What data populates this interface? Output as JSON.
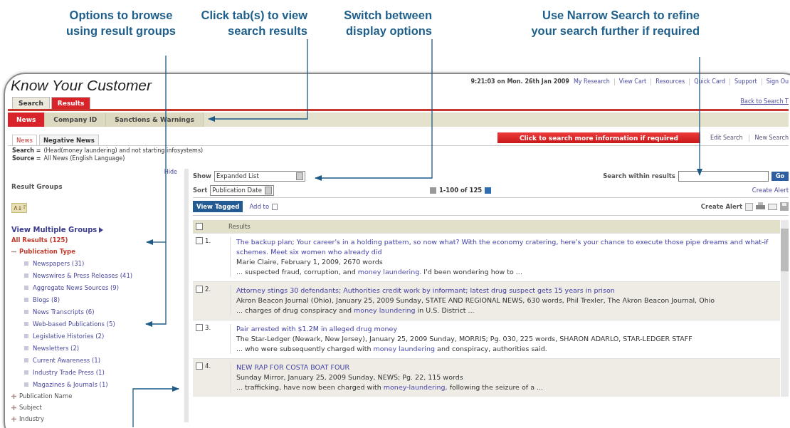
{
  "annotations": [
    {
      "lines": [
        "Options to browse",
        "using result groups"
      ]
    },
    {
      "lines": [
        "Click tab(s) to view",
        "search results"
      ]
    },
    {
      "lines": [
        "Switch between",
        "display options"
      ]
    },
    {
      "lines": [
        "Use Narrow Search to refine",
        "your search further if required"
      ]
    }
  ],
  "header": {
    "title": "Know Your Customer",
    "timestamp": "9:21:03 on Mon. 26th Jan 2009",
    "links": [
      "My Research",
      "View Cart",
      "Resources",
      "Quick Card",
      "Support",
      "Sign Ou"
    ],
    "back_link": "Back to Search T"
  },
  "tabs": [
    {
      "label": "Search",
      "selected": false
    },
    {
      "label": "Results",
      "selected": true
    }
  ],
  "subtabs": [
    {
      "label": "News",
      "selected": true
    },
    {
      "label": "Company ID",
      "selected": false
    },
    {
      "label": "Sanctions & Warnings",
      "selected": false
    }
  ],
  "news_tabs": [
    {
      "label": "News",
      "selected": true
    },
    {
      "label": "Negative News",
      "selected": false
    }
  ],
  "action_button": "Click to search more information if required",
  "search_links": [
    "Edit Search",
    "New Search"
  ],
  "query": {
    "search_label": "Search =",
    "search_value": "(Head(money laundering) and not starting infosystems)",
    "source_label": "Source =",
    "source_value": "All News (English Language)"
  },
  "sidebar": {
    "hide": "Hide",
    "title": "Result Groups",
    "view_multiple": "View Multiple Groups",
    "all_results": "All Results (125)",
    "groups": [
      {
        "label": "Publication Type",
        "expanded": true,
        "children": [
          {
            "label": "Newspapers (31)"
          },
          {
            "label": "Newswires & Press Releases (41)"
          },
          {
            "label": "Aggregate News Sources (9)"
          },
          {
            "label": "Blogs (8)"
          },
          {
            "label": "News Transcripts (6)"
          },
          {
            "label": "Web-based Publications (5)"
          },
          {
            "label": "Legislative Histories (2)"
          },
          {
            "label": "Newsletters (2)"
          },
          {
            "label": "Current Awareness (1)"
          },
          {
            "label": "Industry Trade Press (1)"
          },
          {
            "label": "Magazines & Journals (1)"
          }
        ]
      },
      {
        "label": "Publication Name",
        "expanded": false
      },
      {
        "label": "Subject",
        "expanded": false
      },
      {
        "label": "Industry",
        "expanded": false
      }
    ]
  },
  "toolbar": {
    "show_label": "Show",
    "show_value": "Expanded List",
    "sort_label": "Sort",
    "sort_value": "Publication Date",
    "range": "1-100 of 125",
    "search_within_label": "Search within results",
    "go": "Go",
    "create_alert_link": "Create Alert",
    "view_tagged": "View Tagged",
    "add_to": "Add to",
    "create_alert": "Create Alert"
  },
  "results": {
    "header": "Results",
    "all_checked": false,
    "rows": [
      {
        "number": "1.",
        "checked": false,
        "title": "The backup plan; Your career's in a holding pattern, so now what? With the economy cratering, here's your chance to execute those pipe dreams and what-if schemes. Meet six women who already did",
        "meta": "Marie Claire, February 1, 2009, 2670 words",
        "snippet": {
          "before": "... suspected fraud, corruption, and",
          "term": "money laundering.",
          "after": "I'd been wondering how to  ..."
        }
      },
      {
        "number": "2.",
        "checked": false,
        "title": "Attorney stings 30 defendants; Authorities credit work by informant; latest drug suspect gets 15 years in prison",
        "meta": "Akron Beacon Journal (Ohio), January 25, 2009 Sunday, STATE AND REGIONAL NEWS, 630 words, Phil Trexler, The Akron Beacon Journal, Ohio",
        "snippet": {
          "before": "... charges of drug conspiracy and",
          "term": "money laundering",
          "after": "in U.S. District  ..."
        }
      },
      {
        "number": "3.",
        "checked": false,
        "title": "Pair arrested with $1.2M in alleged drug money",
        "meta": "The Star-Ledger (Newark, New Jersey), January 25, 2009 Sunday, MORRIS; Pg. 030, 225 words, SHARON ADARLO, STAR-LEDGER STAFF",
        "snippet": {
          "before": "... who were subsequently charged with",
          "term": "money laundering",
          "after": "and conspiracy, authorities said."
        }
      },
      {
        "number": "4.",
        "checked": false,
        "title": "NEW RAP FOR COSTA BOAT FOUR",
        "meta": "Sunday Mirror, January 25, 2009 Sunday, NEWS; Pg. 22, 115 words",
        "snippet": {
          "before": "... trafficking, have now been charged with",
          "term": "money-laundering,",
          "after": "following the seizure of a  ..."
        }
      }
    ]
  }
}
